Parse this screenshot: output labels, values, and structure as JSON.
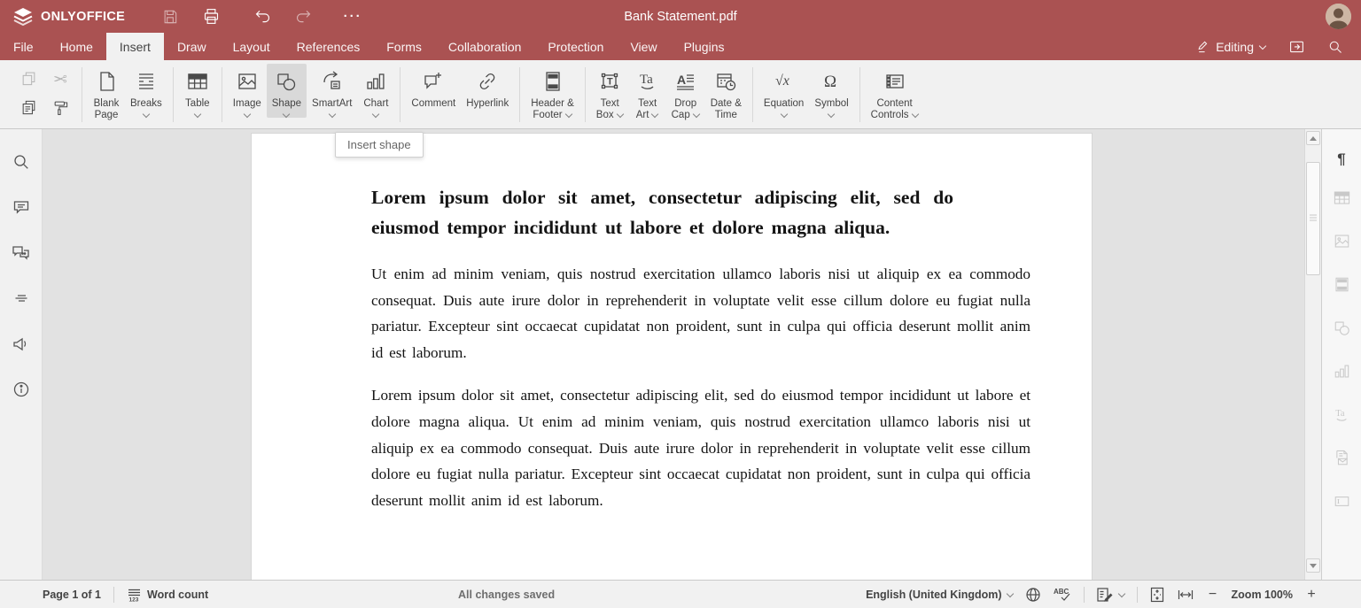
{
  "colors": {
    "brand": "#aa5252",
    "toolbar_bg": "#f1f1f1",
    "doc_bg": "#e2e2e2",
    "page_bg": "#ffffff",
    "text": "#444444"
  },
  "titlebar": {
    "app_name": "ONLYOFFICE",
    "document_title": "Bank Statement.pdf",
    "icons": [
      "onlyoffice-logo",
      "save-icon",
      "print-icon",
      "undo-icon",
      "redo-icon",
      "more-icon",
      "user-avatar"
    ]
  },
  "tabs": {
    "active": "Insert",
    "items": [
      {
        "label": "File"
      },
      {
        "label": "Home"
      },
      {
        "label": "Insert"
      },
      {
        "label": "Draw"
      },
      {
        "label": "Layout"
      },
      {
        "label": "References"
      },
      {
        "label": "Forms"
      },
      {
        "label": "Collaboration"
      },
      {
        "label": "Protection"
      },
      {
        "label": "View"
      },
      {
        "label": "Plugins"
      }
    ],
    "editing_label": "Editing"
  },
  "toolbar": {
    "clipboard_icons": [
      "copy-icon",
      "cut-icon",
      "paste-icon",
      "copy-style-icon"
    ],
    "blank_page": "Blank\nPage",
    "breaks": "Breaks",
    "table": "Table",
    "image": "Image",
    "shape": "Shape",
    "smartart": "SmartArt",
    "chart": "Chart",
    "comment": "Comment",
    "hyperlink": "Hyperlink",
    "header_footer": "Header &\nFooter",
    "text_box": "Text\nBox",
    "text_art": "Text\nArt",
    "drop_cap": "Drop\nCap",
    "date_time": "Date &\nTime",
    "equation": "Equation",
    "symbol": "Symbol",
    "content_controls": "Content\nControls"
  },
  "tooltip": {
    "text": "Insert shape"
  },
  "left_sidebar": {
    "icons": [
      "search",
      "comments",
      "chat",
      "navigation",
      "feedback",
      "about"
    ]
  },
  "right_sidebar": {
    "icons": [
      "paragraph-settings",
      "table-settings",
      "image-settings",
      "header-footer-settings",
      "shape-settings",
      "chart-settings",
      "text-art-settings",
      "mail-merge",
      "text-box-settings"
    ]
  },
  "glyphs": {
    "scissors": "✂",
    "paragraph": "¶",
    "omega": "Ω",
    "sqrt": "√x",
    "ta": "Ta",
    "more": "···",
    "minus": "−",
    "plus": "+",
    "drop_cap_a": "A",
    "textbox_t": "T",
    "numbers": "123",
    "abc": "ABC"
  },
  "document": {
    "heading": "Lorem ipsum dolor sit amet, consectetur adipiscing elit, sed do eiusmod tempor incididunt ut labore et dolore magna aliqua.",
    "paragraphs": [
      "Ut enim ad minim veniam, quis nostrud exercitation ullamco laboris nisi ut aliquip ex ea commodo consequat. Duis aute irure dolor in reprehenderit in voluptate velit esse cillum dolore eu fugiat nulla pariatur. Excepteur sint occaecat cupidatat non proident, sunt in culpa qui officia deserunt mollit anim id est laborum.",
      "Lorem ipsum dolor sit amet, consectetur adipiscing elit, sed do eiusmod tempor incididunt ut labore et dolore magna aliqua. Ut enim ad minim veniam, quis nostrud exercitation ullamco laboris nisi ut aliquip ex ea commodo consequat. Duis aute irure dolor in reprehenderit in voluptate velit esse cillum dolore eu fugiat nulla pariatur. Excepteur sint occaecat cupidatat non proident, sunt in culpa qui officia deserunt mollit anim id est laborum."
    ]
  },
  "statusbar": {
    "page_indicator": "Page 1 of 1",
    "word_count_label": "Word count",
    "save_status": "All changes saved",
    "language": "English (United Kingdom)",
    "zoom_label": "Zoom 100%"
  }
}
